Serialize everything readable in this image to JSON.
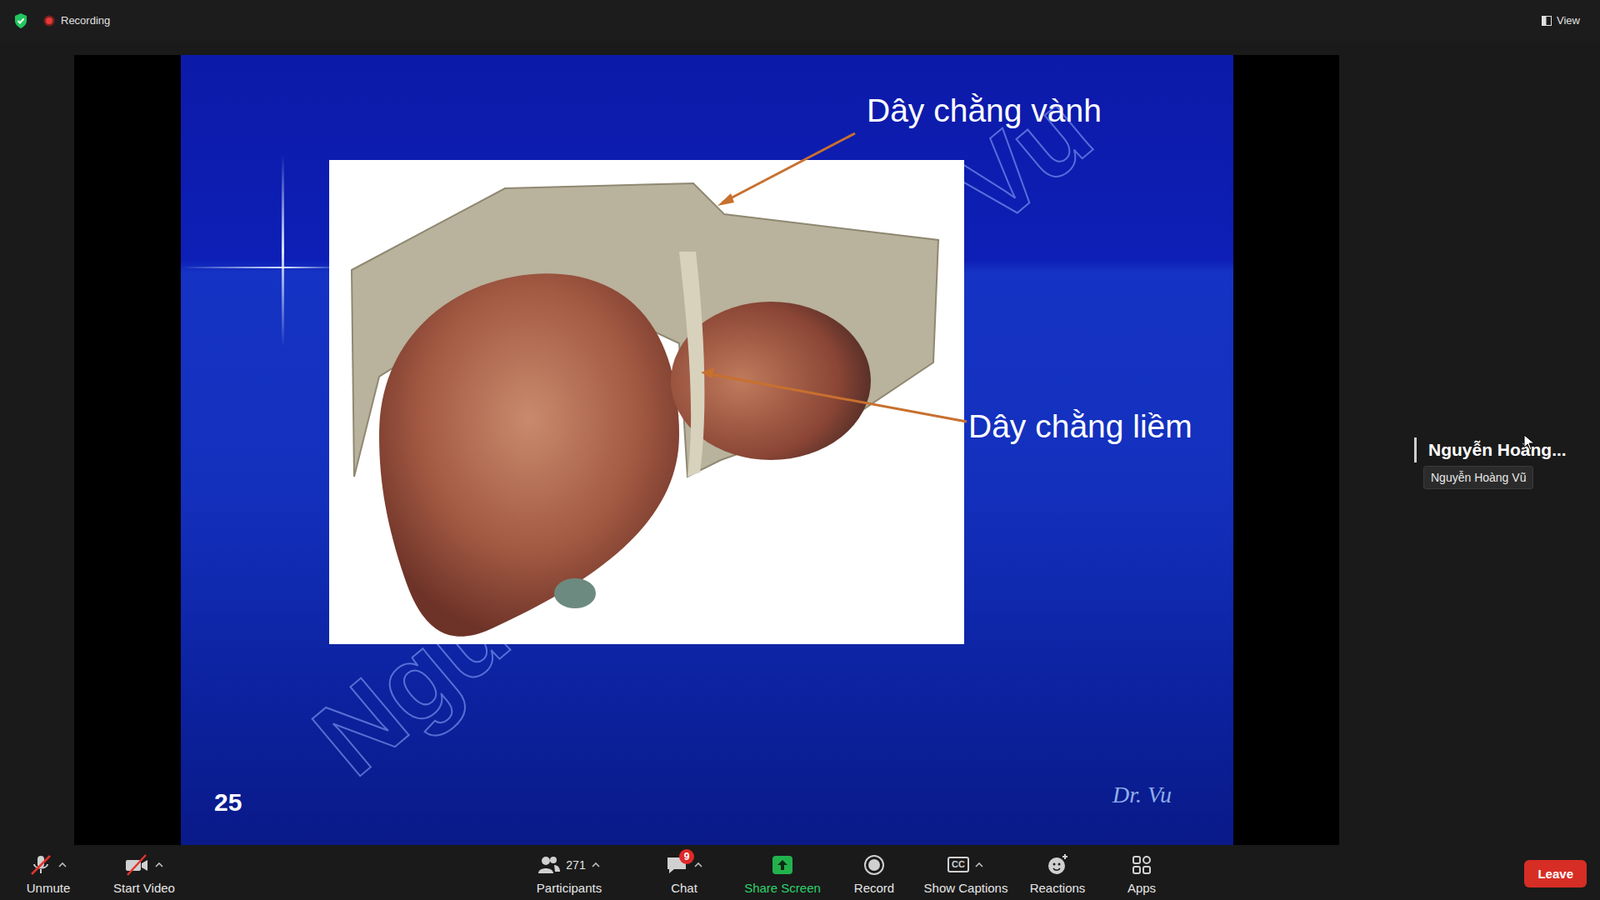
{
  "top_bar": {
    "recording_label": "Recording",
    "view_label": "View"
  },
  "slide": {
    "labels": [
      "Dây chằng vành",
      "Dây chằng liềm"
    ],
    "page_number": "25",
    "author": "Dr. Vu",
    "watermark": [
      "Ngu",
      "Vu"
    ]
  },
  "speaker": {
    "name": "Nguyễn Hoàng...",
    "tooltip": "Nguyễn Hoàng Vũ"
  },
  "toolbar": {
    "buttons": [
      {
        "label": "Unmute",
        "kind": "mic",
        "off": true,
        "menu": true,
        "group": "left"
      },
      {
        "label": "Start Video",
        "kind": "video",
        "off": true,
        "menu": true,
        "group": "left"
      },
      {
        "label": "Participants",
        "kind": "participants",
        "off": false,
        "menu": true,
        "group": "center",
        "count": "271"
      },
      {
        "label": "Chat",
        "kind": "chat",
        "off": false,
        "menu": true,
        "group": "center",
        "badge": "9"
      },
      {
        "label": "Share Screen",
        "kind": "share",
        "off": false,
        "menu": false,
        "group": "center"
      },
      {
        "label": "Record",
        "kind": "record",
        "off": false,
        "menu": false,
        "group": "center"
      },
      {
        "label": "Show Captions",
        "kind": "captions",
        "off": false,
        "menu": true,
        "group": "center",
        "icon_text": "CC"
      },
      {
        "label": "Reactions",
        "kind": "reactions",
        "off": false,
        "menu": false,
        "group": "center"
      },
      {
        "label": "Apps",
        "kind": "apps",
        "off": false,
        "menu": false,
        "group": "center"
      }
    ],
    "leave": "Leave"
  }
}
